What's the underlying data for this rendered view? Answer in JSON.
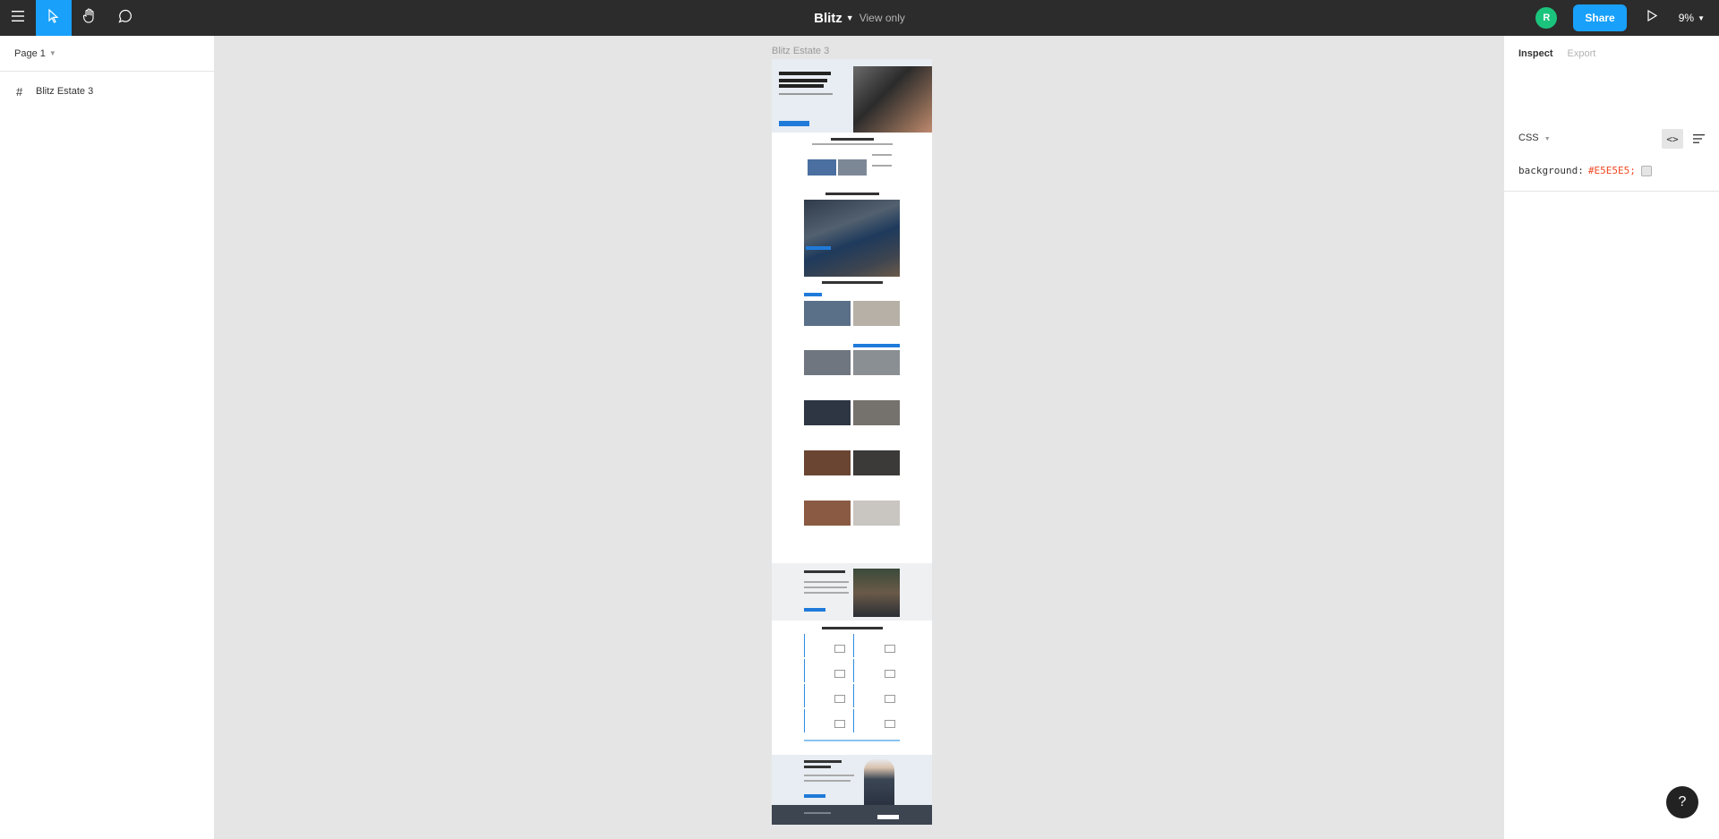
{
  "toolbar": {
    "file_name": "Blitz",
    "view_mode": "View only",
    "avatar_initial": "R",
    "share_label": "Share",
    "zoom": "9%"
  },
  "left_panel": {
    "page_label": "Page 1",
    "layers": [
      {
        "name": "Blitz Estate 3"
      }
    ]
  },
  "canvas": {
    "frame_label": "Blitz Estate 3",
    "background": "#E5E5E5"
  },
  "right_panel": {
    "tabs": [
      "Inspect",
      "Export"
    ],
    "active_tab": "Inspect",
    "code_language": "CSS",
    "css_property": "background:",
    "css_value": "#E5E5E5;"
  },
  "colors": {
    "toolbar_bg": "#2c2c2c",
    "accent": "#18a0fb",
    "avatar": "#1bc47d",
    "css_value": "#f24822"
  }
}
